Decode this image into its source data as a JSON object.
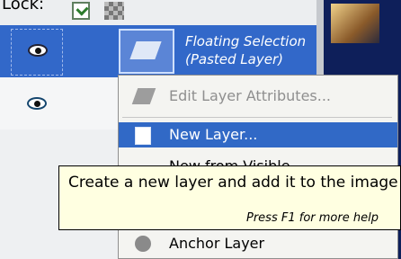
{
  "lock_bar": {
    "label": "Lock:"
  },
  "layers": [
    {
      "name_line1": "Floating Selection",
      "name_line2": "(Pasted Layer)"
    }
  ],
  "context_menu": {
    "items": [
      {
        "label": "Edit Layer Attributes..."
      },
      {
        "label": "New Layer..."
      },
      {
        "label": "New from Visible"
      },
      {
        "label": "Anchor Layer"
      }
    ]
  },
  "tooltip": {
    "text": "Create a new layer and add it to the image",
    "help": "Press F1 for more help"
  }
}
